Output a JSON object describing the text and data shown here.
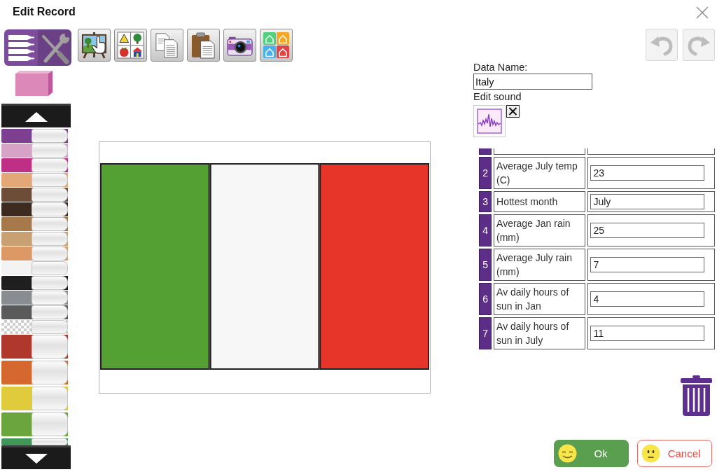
{
  "window": {
    "title": "Edit Record"
  },
  "mode_button": {
    "selected": true
  },
  "toolbar": [
    {
      "kind": "easel"
    },
    {
      "kind": "clipart"
    },
    {
      "kind": "copy"
    },
    {
      "kind": "paste"
    },
    {
      "kind": "camera"
    },
    {
      "kind": "houses"
    }
  ],
  "palette": {
    "pens": [
      {
        "kind": "fine",
        "color": "#7d3f90"
      },
      {
        "kind": "fine",
        "color": "#d6a3c6"
      },
      {
        "kind": "fine",
        "color": "#bf2f85"
      },
      {
        "kind": "fine",
        "color": "#e4a878"
      },
      {
        "kind": "fine",
        "color": "#6d4c38"
      },
      {
        "kind": "fine",
        "color": "#3e2b20"
      },
      {
        "kind": "fine",
        "color": "#a6784a"
      },
      {
        "kind": "fine",
        "color": "#c9a071"
      },
      {
        "kind": "fine",
        "color": "#dc9865"
      },
      {
        "kind": "fine",
        "color": "#f3f3f3"
      },
      {
        "kind": "fine",
        "color": "#1f1f1f"
      },
      {
        "kind": "fine",
        "color": "#898c90"
      },
      {
        "kind": "fine",
        "color": "#5a5a5a"
      },
      {
        "kind": "clear"
      },
      {
        "kind": "broad",
        "color": "#b0372b"
      },
      {
        "kind": "broad",
        "color": "#d4682f"
      },
      {
        "kind": "broad",
        "color": "#dfcb3b"
      },
      {
        "kind": "broad",
        "color": "#6aa63d"
      },
      {
        "kind": "broad",
        "color": "#3f9656"
      }
    ]
  },
  "canvas": {
    "stripes": [
      {
        "color": "#55a033"
      },
      {
        "color": "#f7f7f7"
      },
      {
        "color": "#e8352a"
      }
    ]
  },
  "history": [
    {
      "kind": "undo",
      "disabled": true
    },
    {
      "kind": "redo",
      "disabled": true
    }
  ],
  "record": {
    "name_label": "Data Name:",
    "name_value": "Italy",
    "sound_label": "Edit sound"
  },
  "table": {
    "rows": [
      {
        "kind": "clipped"
      },
      {
        "kind": "field",
        "number": "2",
        "label": "Average July temp (C)",
        "value": "23"
      },
      {
        "kind": "field",
        "number": "3",
        "label": "Hottest month",
        "value": "July"
      },
      {
        "kind": "field",
        "number": "4",
        "label": "Average Jan rain (mm)",
        "value": "25"
      },
      {
        "kind": "field",
        "number": "5",
        "label": "Average July rain (mm)",
        "value": "7"
      },
      {
        "kind": "field",
        "number": "6",
        "label": "Av daily hours of sun in Jan",
        "value": "4"
      },
      {
        "kind": "field",
        "number": "7",
        "label": "Av daily hours of sun in July",
        "value": "11"
      }
    ]
  },
  "buttons": [
    {
      "kind": "ok",
      "label": "Ok"
    },
    {
      "kind": "cancel",
      "label": "Cancel"
    }
  ]
}
